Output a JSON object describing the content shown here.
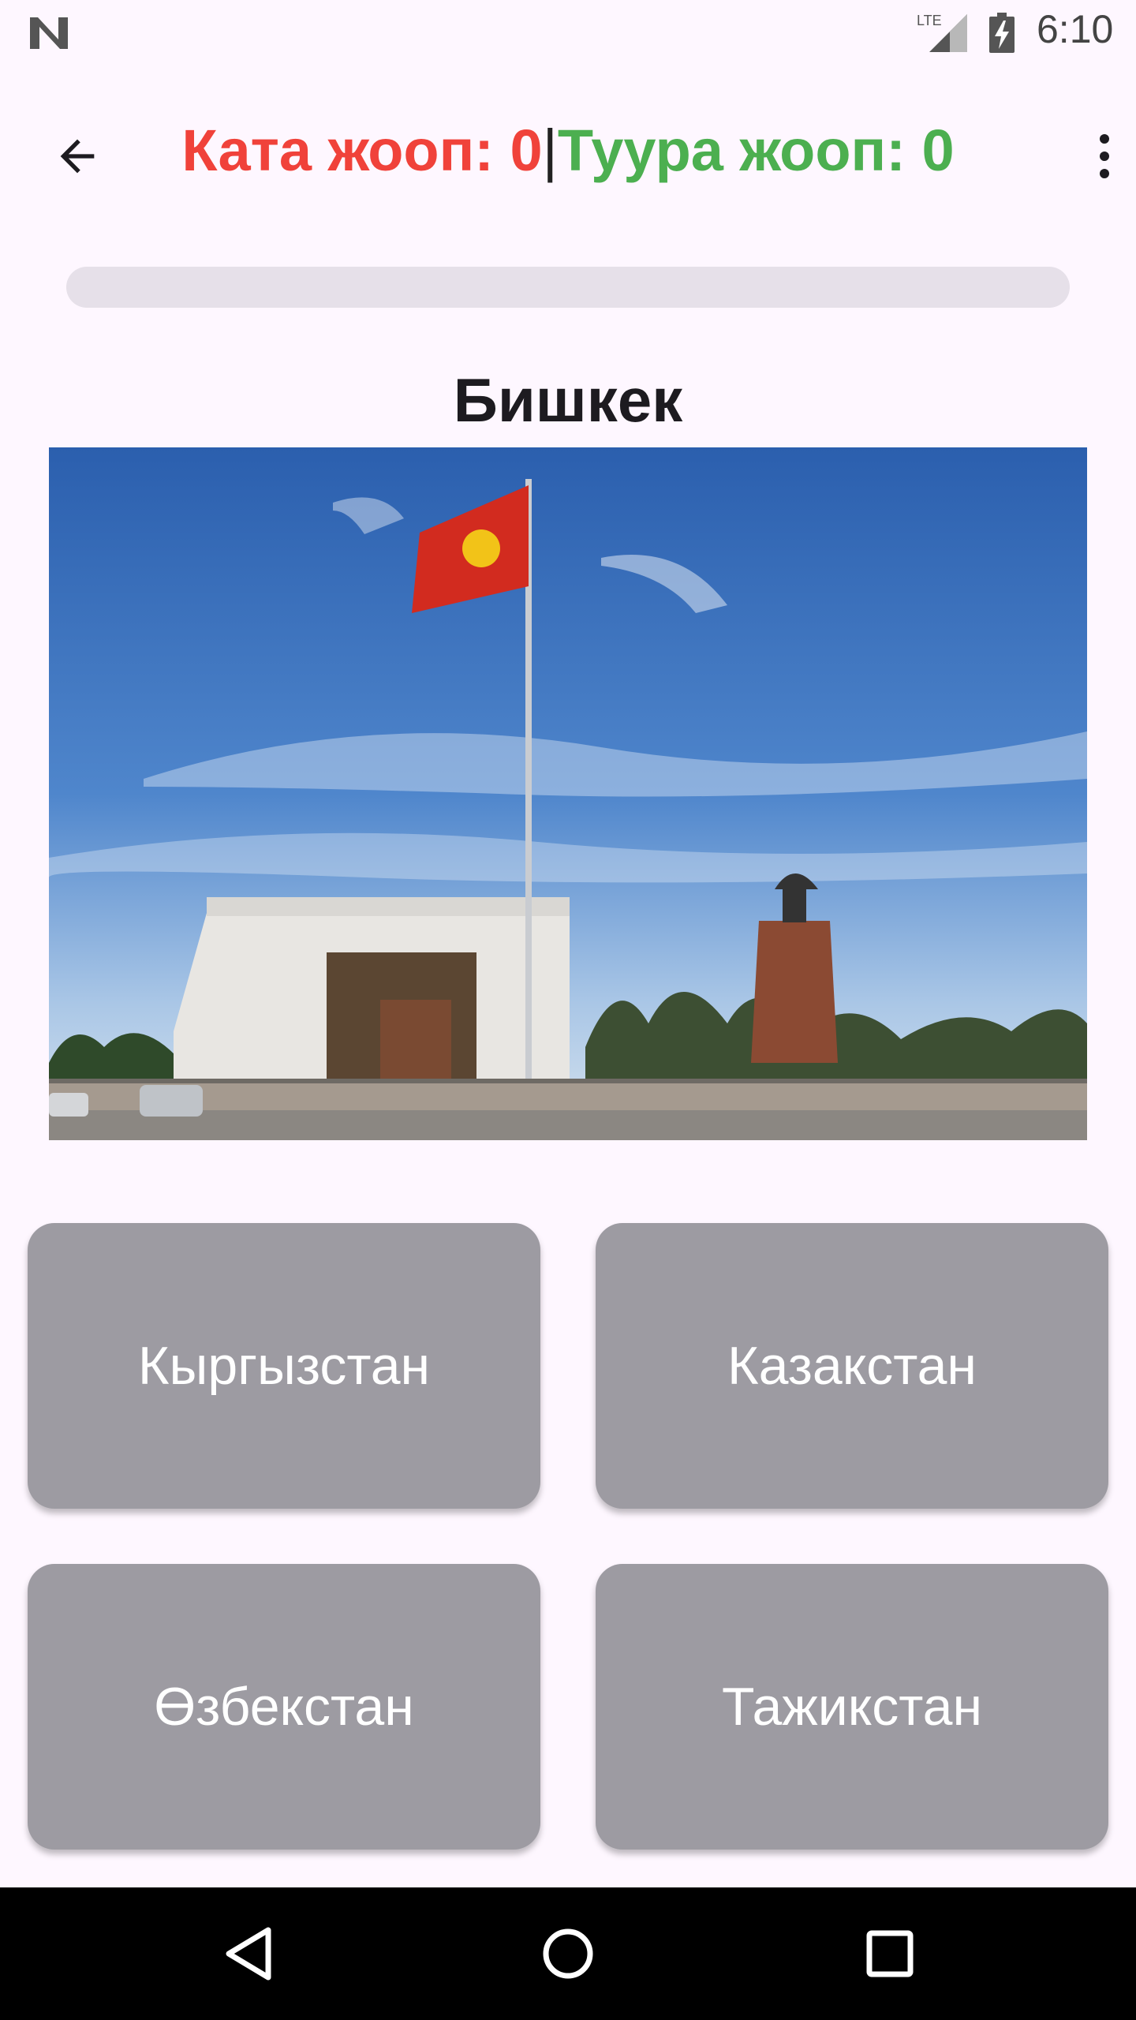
{
  "status_bar": {
    "time": "6:10",
    "network_label": "LTE",
    "icons": [
      "n-icon",
      "lte-signal-icon",
      "battery-charging-icon"
    ]
  },
  "app_bar": {
    "wrong_label": "Ката жооп: 0",
    "separator": "|",
    "right_label": "Туура жооп: 0",
    "icons": [
      "back-arrow-icon",
      "more-vert-icon"
    ],
    "colors": {
      "wrong": "#f0423a",
      "right": "#4caf50"
    }
  },
  "quiz": {
    "progress": 0,
    "question": "Бишкек",
    "answers": [
      "Кыргызстан",
      "Казакстан",
      "Өзбекстан",
      "Тажикстан"
    ],
    "button_color": "#9d9ba2"
  },
  "nav_bar": {
    "icons": [
      "nav-back-icon",
      "nav-home-icon",
      "nav-recents-icon"
    ]
  }
}
